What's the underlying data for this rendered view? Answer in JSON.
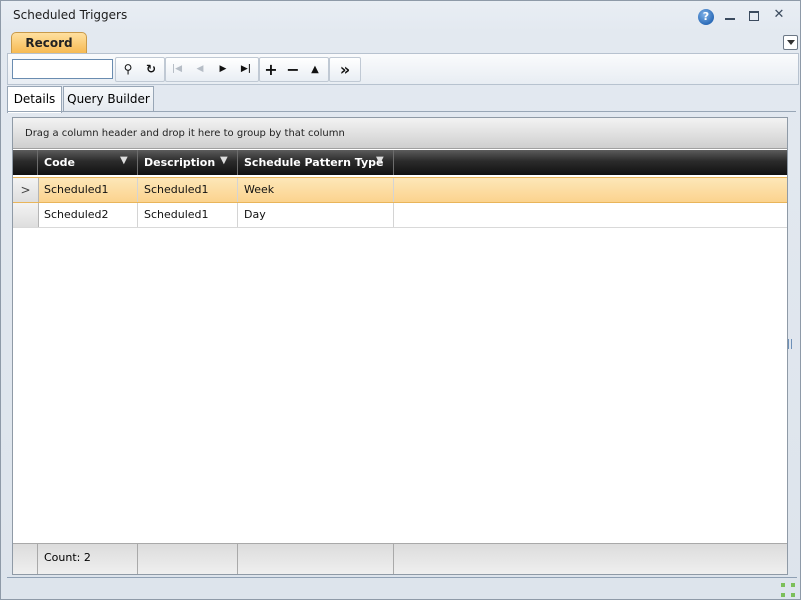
{
  "window": {
    "title": "Scheduled Triggers",
    "help_icon": "question-icon",
    "help_glyph": "?",
    "close_glyph": "✕"
  },
  "ribbon": {
    "tab_label": "Record"
  },
  "toolbar": {
    "search_value": "",
    "search_icon": "⚲",
    "refresh_icon": "↻",
    "first_icon": "|◀",
    "prev_icon": "◀",
    "next_icon": "▶",
    "last_icon": "▶|",
    "add_icon": "+",
    "remove_icon": "−",
    "up_icon": "▲",
    "more_icon": "»"
  },
  "tabs": [
    {
      "label": "Details"
    },
    {
      "label": "Query Builder"
    }
  ],
  "grid": {
    "group_hint": "Drag a column header and drop it here to group by that column",
    "columns": [
      {
        "label": "Code"
      },
      {
        "label": "Description"
      },
      {
        "label": "Schedule Pattern Type"
      }
    ],
    "filter_glyph": "▼",
    "selected_marker": ">",
    "rows": [
      {
        "code": "Scheduled1",
        "description": "Scheduled1",
        "pattern": "Week"
      },
      {
        "code": "Scheduled2",
        "description": "Scheduled1",
        "pattern": "Day"
      }
    ],
    "footer_count": "Count: 2"
  },
  "colors": {
    "selected_row": "#fbd38e",
    "ribbon_tab": "#f6b84e",
    "header_dark": "#111111"
  }
}
